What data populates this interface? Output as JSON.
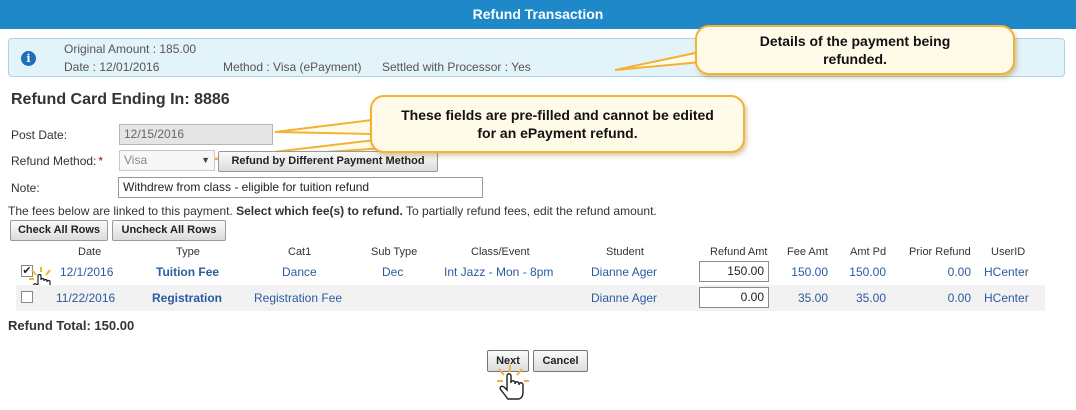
{
  "window": {
    "title": "Refund Transaction"
  },
  "info": {
    "original_amount": "Original Amount : 185.00",
    "date": "Date : 12/01/2016",
    "method": "Method : Visa (ePayment)",
    "settled": "Settled with Processor : Yes"
  },
  "callouts": {
    "details": "Details of the payment being refunded.",
    "prefilled": "These fields are pre-filled and cannot be edited for an ePayment refund."
  },
  "heading": "Refund Card Ending In: 8886",
  "form": {
    "post_date_label": "Post Date:",
    "post_date_value": "12/15/2016",
    "refund_method_label": "Refund Method:",
    "refund_method_required": "*",
    "refund_method_value": "Visa",
    "different_method_button": "Refund by Different Payment Method",
    "note_label": "Note:",
    "note_value": "Withdrew from class - eligible for tuition refund"
  },
  "instructions": {
    "part1": "The fees below are linked to this payment. ",
    "part2": "Select which fee(s) to refund.",
    "part3": " To partially refund fees, edit the refund amount."
  },
  "buttons": {
    "check_all": "Check All Rows",
    "uncheck_all": "Uncheck All Rows",
    "next": "Next",
    "cancel": "Cancel"
  },
  "table": {
    "columns": [
      "Date",
      "Type",
      "Cat1",
      "Sub Type",
      "Class/Event",
      "Student",
      "Refund Amt",
      "Fee Amt",
      "Amt Pd",
      "Prior Refund",
      "UserID"
    ],
    "rows": [
      {
        "checked": true,
        "date": "12/1/2016",
        "type": "Tuition Fee",
        "cat1": "Dance",
        "sub_type": "Dec",
        "class_event": "Int Jazz - Mon - 8pm",
        "student": "Dianne Ager",
        "refund_amt": "150.00",
        "fee_amt": "150.00",
        "amt_pd": "150.00",
        "prior_refund": "0.00",
        "user_id": "HCenter"
      },
      {
        "checked": false,
        "date": "11/22/2016",
        "type": "Registration",
        "cat1": "Registration Fee",
        "sub_type": "",
        "class_event": "",
        "student": "Dianne Ager",
        "refund_amt": "0.00",
        "fee_amt": "35.00",
        "amt_pd": "35.00",
        "prior_refund": "0.00",
        "user_id": "HCenter"
      }
    ]
  },
  "refund_total": "Refund Total: 150.00",
  "icons": {
    "info": "info-icon",
    "dropdown": "chevron-down-icon",
    "cursor": "hand-pointer-icon",
    "checkbox": "checkbox-icon"
  },
  "colors": {
    "title_bar": "#1f88c9",
    "info_bg": "#e3f3fa",
    "callout_border": "#f2b233",
    "link_text": "#2c5aa0"
  }
}
